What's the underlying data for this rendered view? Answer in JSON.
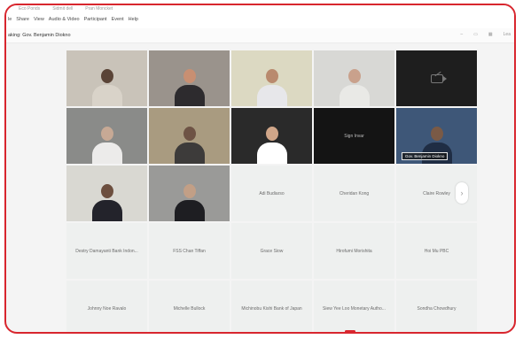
{
  "topbar": {
    "blurred": [
      "Eco Ponds",
      "Sidmit dell",
      "Pran Moncket"
    ],
    "menu": [
      "le",
      "Share",
      "View",
      "Audio & Video",
      "Participant",
      "Event",
      "Help"
    ]
  },
  "subbar": {
    "speaker_text": "aking: Gov. Benjamin Diokno",
    "controls": [
      "Lea"
    ]
  },
  "tiles": [
    {
      "name": "",
      "kind": "video",
      "bg": "#c9c3b9",
      "skin": "#5a4437",
      "shirt": "#d9d3c9"
    },
    {
      "name": "",
      "kind": "video",
      "bg": "#9a938c",
      "skin": "#c88f72",
      "shirt": "#2d2b2e"
    },
    {
      "name": "",
      "kind": "video",
      "bg": "#dcd9c2",
      "skin": "#b98a6e",
      "shirt": "#e7e7ea"
    },
    {
      "name": "",
      "kind": "video",
      "bg": "#d8d8d5",
      "skin": "#c9a18c",
      "shirt": "#e9e9e6"
    },
    {
      "name": "",
      "kind": "camoff",
      "bg": "#1e1e1e"
    },
    {
      "name": "",
      "kind": "video",
      "bg": "#8a8b89",
      "skin": "#c7a995",
      "shirt": "#ecebea"
    },
    {
      "name": "",
      "kind": "video",
      "bg": "#a99b80",
      "skin": "#6e5345",
      "shirt": "#3d3b3a"
    },
    {
      "name": "",
      "kind": "video",
      "bg": "#2a2a2a",
      "skin": "#d0a689",
      "shirt": "#ffffff"
    },
    {
      "name": "Sign Invar",
      "kind": "dark",
      "bg": "#141414"
    },
    {
      "name": "Gov. Benjamin Diokno",
      "kind": "video-label",
      "bg": "#3e5778",
      "skin": "#7a5a46",
      "shirt": "#1f2d44"
    },
    {
      "name": "",
      "kind": "video",
      "bg": "#d9d8d2",
      "skin": "#6d4f3f",
      "shirt": "#23232b"
    },
    {
      "name": "",
      "kind": "video",
      "bg": "#9a9a98",
      "skin": "#c29f86",
      "shirt": "#1e1e22"
    },
    {
      "name": "Adi Budiarso",
      "kind": "name"
    },
    {
      "name": "Cheridan Kong",
      "kind": "name"
    },
    {
      "name": "Claire Rowley",
      "kind": "name"
    },
    {
      "name": "Destry Damayanti Bank Indon...",
      "kind": "name"
    },
    {
      "name": "FSS Chan Tiffan",
      "kind": "name"
    },
    {
      "name": "Grace Siow",
      "kind": "name"
    },
    {
      "name": "Hirofumi Morishita",
      "kind": "name"
    },
    {
      "name": "Hoi Mu PBC",
      "kind": "name"
    },
    {
      "name": "Johnny Noe Ravalo",
      "kind": "name"
    },
    {
      "name": "Michelle Bullock",
      "kind": "name"
    },
    {
      "name": "Michinobu Kishi Bank of Japan",
      "kind": "name"
    },
    {
      "name": "Siew Yee Loo Monetary Autho...",
      "kind": "name"
    },
    {
      "name": "Sondha Chowdhury",
      "kind": "name"
    }
  ],
  "next_arrow": "›",
  "colors": {
    "frame": "#d8262e",
    "tile_bg": "#eef0ef"
  }
}
